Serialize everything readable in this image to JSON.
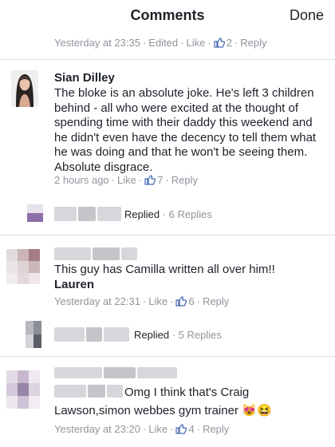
{
  "header": {
    "title": "Comments",
    "done_label": "Done"
  },
  "top_meta": {
    "time": "Yesterday at 23:35",
    "edited": "Edited",
    "like": "Like",
    "likes": "2",
    "reply": "Reply"
  },
  "comments": [
    {
      "author": "Sian Dilley",
      "text": "The bloke is an absolute joke. He's left 3 children behind - all who were excited at the thought of spending time with their daddy this weekend and he didn't even have the decency to tell them what he was doing and that he won't be seeing them. Absolute disgrace.",
      "time": "2 hours ago",
      "like": "Like",
      "likes": "7",
      "reply": "Reply",
      "replies": {
        "label": "Replied",
        "count": "6 Replies"
      }
    },
    {
      "text": "This guy has Camilla written all over him!!",
      "tag": "Lauren",
      "time": "Yesterday at 22:31",
      "like": "Like",
      "likes": "6",
      "reply": "Reply",
      "replies": {
        "label": "Replied",
        "count": "5 Replies"
      }
    },
    {
      "text_line1": "Omg I think that's Craig",
      "text_line2": "Lawson,simon webbes gym trainer",
      "emojis": "😻😆",
      "time": "Yesterday at 23:20",
      "like": "Like",
      "likes": "4",
      "reply": "Reply"
    }
  ],
  "colors": {
    "meta": "#90949c",
    "text": "#1d2129",
    "like_blue": "#4267b2",
    "divider": "#dddfe2"
  },
  "icons": {
    "like": "thumbs-up-icon"
  }
}
